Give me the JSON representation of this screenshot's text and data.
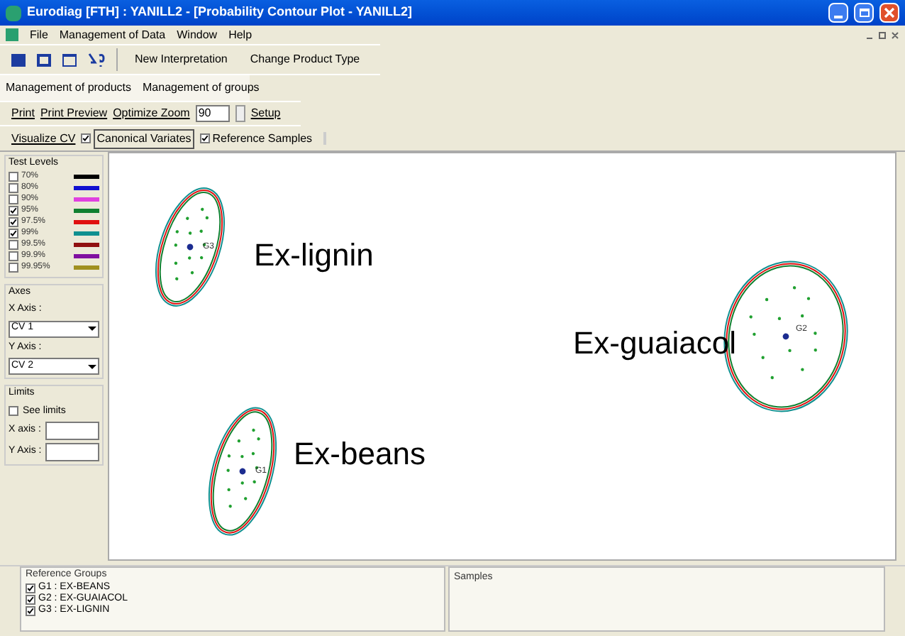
{
  "window": {
    "title": "Eurodiag [FTH] : YANILL2 - [Probability Contour Plot - YANILL2]"
  },
  "menu": [
    "File",
    "Management of Data",
    "Window",
    "Help"
  ],
  "toolbar": {
    "buttons": [
      "New Interpretation",
      "Change Product Type"
    ]
  },
  "tabs": [
    {
      "label": "Management of products",
      "selected": false
    },
    {
      "label": "Management of groups",
      "selected": false
    }
  ],
  "print_bar": {
    "print": "Print",
    "preview": "Print Preview",
    "zoom_label": "Optimize Zoom",
    "zoom_value": "90",
    "setup": "Setup"
  },
  "view_bar": {
    "label": "Visualize CV",
    "options": [
      {
        "label": "Canonical Variates",
        "checked": true
      },
      {
        "label": "Reference Samples",
        "checked": true
      }
    ]
  },
  "test_levels": {
    "title": "Test Levels",
    "items": [
      {
        "label": "70%",
        "checked": false,
        "color": "#000000"
      },
      {
        "label": "80%",
        "checked": false,
        "color": "#1010d0"
      },
      {
        "label": "90%",
        "checked": false,
        "color": "#e040e0"
      },
      {
        "label": "95%",
        "checked": true,
        "color": "#108030"
      },
      {
        "label": "97.5%",
        "checked": true,
        "color": "#e01010"
      },
      {
        "label": "99%",
        "checked": true,
        "color": "#109090"
      },
      {
        "label": "99.5%",
        "checked": false,
        "color": "#901010"
      },
      {
        "label": "99.9%",
        "checked": false,
        "color": "#8010a0"
      },
      {
        "label": "99.95%",
        "checked": false,
        "color": "#a09020"
      }
    ]
  },
  "axes": {
    "title": "Axes",
    "x_label": "X Axis :",
    "x_value": "CV 1",
    "y_label": "Y Axis :",
    "y_value": "CV 2"
  },
  "limits": {
    "title": "Limits",
    "see_limits": {
      "label": "See limits",
      "checked": false
    },
    "x_label": "X axis :",
    "y_label": "Y Axis :"
  },
  "plot": {
    "groups": [
      {
        "id": "G3",
        "label": "Ex-lignin"
      },
      {
        "id": "G2",
        "label": "Ex-guaiacol"
      },
      {
        "id": "G1",
        "label": "Ex-beans"
      }
    ]
  },
  "reference_groups": {
    "title": "Reference Groups",
    "items": [
      {
        "label": "G1 : EX-BEANS",
        "checked": true
      },
      {
        "label": "G2 : EX-GUAIACOL",
        "checked": true
      },
      {
        "label": "G3 : EX-LIGNIN",
        "checked": true
      }
    ]
  },
  "samples": {
    "title": "Samples"
  }
}
